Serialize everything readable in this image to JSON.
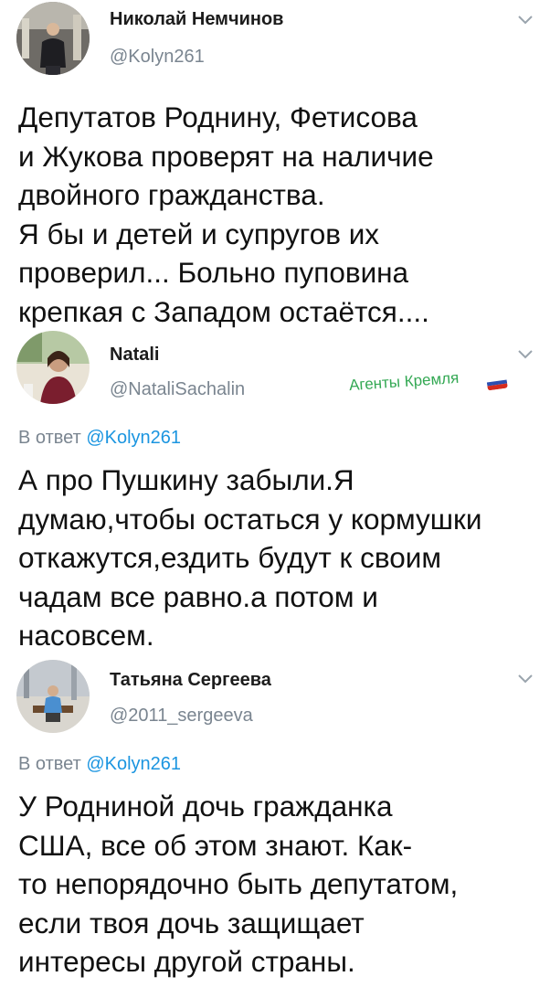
{
  "tweets": [
    {
      "name": "Николай Немчинов",
      "handle": "@Kolyn261",
      "text": "Депутатов Роднину, Фетисова\nи Жукова проверят на наличие\nдвойного гражданства.\nЯ бы и детей и супругов  их\nпроверил... Больно пуповина\nкрепкая с Западом остаётся....",
      "avatar_icon": "user-photo-icon",
      "menu_icon": "chevron-down-icon"
    },
    {
      "name": "Natali",
      "handle": "@NataliSachalin",
      "badge": "Агенты Кремля",
      "badge_icon": "russian-flag-icon",
      "reply_prefix": "В ответ",
      "reply_to": "@Kolyn261",
      "text": "А про Пушкину забыли.Я\nдумаю,чтобы остаться у кормушки\nоткажутся,ездить будут к своим\nчадам все равно.а потом и\nнасовсем.",
      "avatar_icon": "user-photo-icon",
      "menu_icon": "chevron-down-icon"
    },
    {
      "name": "Татьяна Сергеева",
      "handle": "@2011_sergeeva",
      "reply_prefix": "В ответ",
      "reply_to": "@Kolyn261",
      "text": "У Родниной дочь гражданка\nСША, все об этом знают. Как-\nто непорядочно быть депутатом,\nесли твоя дочь защищает\nинтересы другой страны.",
      "avatar_icon": "user-photo-icon",
      "menu_icon": "chevron-down-icon"
    }
  ],
  "colors": {
    "handle": "#7a8590",
    "mention": "#1b95e0",
    "badge": "#33a853",
    "text": "#111111"
  }
}
